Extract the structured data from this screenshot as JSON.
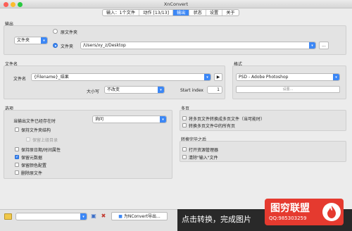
{
  "window": {
    "title": "XnConvert"
  },
  "tabs": [
    "输入：1个文件",
    "动作 [13/13]",
    "输出",
    "状态",
    "设置",
    "关于"
  ],
  "output": {
    "section": "输出",
    "location_select": "文件夹",
    "radio_original": "原文件夹",
    "radio_folder": "文件夹",
    "folder_path": "/Users/xy_z/Desktop",
    "browse_label": "..."
  },
  "filename": {
    "section": "文件名",
    "label": "文件名",
    "value": "{Filename}_结果",
    "case_label": "大小写",
    "case_value": "不改变",
    "start_index_label": "Start index",
    "start_index_value": "1"
  },
  "format": {
    "section": "格式",
    "value": "PSD - Adobe Photoshop",
    "settings_label": "设置..."
  },
  "options": {
    "section": "选项",
    "exists_label": "当输出文件已经存在时",
    "exists_value": "询问",
    "keep_structure": "保持文件夹结构",
    "keep_parent": "保留上级目录",
    "keep_date": "保持原日期/时间属性",
    "keep_metadata": "保留元数据",
    "keep_color": "保留颜色配置",
    "delete_original": "删除原文件"
  },
  "multipage": {
    "section": "多页",
    "merge": "将多页文件转换成多页文件（当可能时）",
    "convert_all": "转换多页文件中的所有页"
  },
  "after": {
    "section": "转换完毕之后",
    "open_explorer": "打开资源管理器",
    "clear_input": "清除\"输入\"文件"
  },
  "bottom": {
    "export_button": "为NConvert导出...",
    "caption": "点击转换，完成图片",
    "brand_name": "图穷联盟",
    "brand_qq": "QQ:985303259"
  },
  "colors": {
    "accent": "#3c87f5",
    "brand_red": "#e53a2f"
  },
  "icons": {
    "close": "close-dot",
    "minimize": "minimize-dot",
    "maximize": "maximize-dot",
    "dropdown": "chevron-down-icon",
    "play": "play-icon",
    "save": "save-icon",
    "delete": "delete-icon",
    "export": "export-icon",
    "brand": "brand-logo"
  }
}
